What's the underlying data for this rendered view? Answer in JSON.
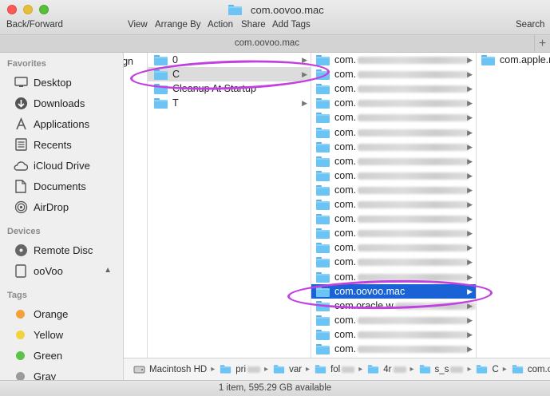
{
  "window": {
    "title": "com.oovoo.mac",
    "tab_title": "com.oovoo.mac",
    "new_tab": "+"
  },
  "toolbar": {
    "back_forward": "Back/Forward",
    "view": "View",
    "arrange_by": "Arrange By",
    "action": "Action",
    "share": "Share",
    "add_tags": "Add Tags",
    "search": "Search"
  },
  "sidebar": {
    "favorites_header": "Favorites",
    "favorites": [
      {
        "label": "Desktop",
        "icon": "desktop-icon"
      },
      {
        "label": "Downloads",
        "icon": "downloads-icon"
      },
      {
        "label": "Applications",
        "icon": "applications-icon"
      },
      {
        "label": "Recents",
        "icon": "recents-icon"
      },
      {
        "label": "iCloud Drive",
        "icon": "icloud-icon"
      },
      {
        "label": "Documents",
        "icon": "documents-icon"
      },
      {
        "label": "AirDrop",
        "icon": "airdrop-icon"
      }
    ],
    "devices_header": "Devices",
    "devices": [
      {
        "label": "Remote Disc",
        "icon": "disc-icon"
      },
      {
        "label": "ooVoo",
        "icon": "drive-icon"
      }
    ],
    "tags_header": "Tags",
    "tags": [
      {
        "label": "Orange",
        "color": "#f5a13a"
      },
      {
        "label": "Yellow",
        "color": "#f2d33b"
      },
      {
        "label": "Green",
        "color": "#5ac348"
      },
      {
        "label": "Gray",
        "color": "#9b9b9b"
      }
    ]
  },
  "columns": {
    "col0_fragment": "gn",
    "col1": [
      {
        "name": "0",
        "has_children": true,
        "state": "normal"
      },
      {
        "name": "C",
        "has_children": true,
        "state": "gray"
      },
      {
        "name": "Cleanup At Startup",
        "has_children": false,
        "state": "normal"
      },
      {
        "name": "T",
        "has_children": true,
        "state": "normal"
      }
    ],
    "col2": [
      {
        "prefix": "com.",
        "redacted": true,
        "has_children": true,
        "state": "normal"
      },
      {
        "prefix": "com.",
        "redacted": true,
        "has_children": true,
        "state": "normal"
      },
      {
        "prefix": "com.",
        "redacted": true,
        "has_children": true,
        "state": "normal"
      },
      {
        "prefix": "com.",
        "redacted": true,
        "has_children": true,
        "state": "normal"
      },
      {
        "prefix": "com.",
        "redacted": true,
        "has_children": true,
        "state": "normal"
      },
      {
        "prefix": "com.",
        "redacted": true,
        "has_children": true,
        "state": "normal"
      },
      {
        "prefix": "com.",
        "redacted": true,
        "has_children": true,
        "state": "normal"
      },
      {
        "prefix": "com.",
        "redacted": true,
        "has_children": true,
        "state": "normal"
      },
      {
        "prefix": "com.",
        "redacted": true,
        "has_children": true,
        "state": "normal"
      },
      {
        "prefix": "com.",
        "redacted": true,
        "has_children": true,
        "state": "normal"
      },
      {
        "prefix": "com.",
        "redacted": true,
        "has_children": true,
        "state": "normal"
      },
      {
        "prefix": "com.",
        "redacted": true,
        "has_children": true,
        "state": "normal"
      },
      {
        "prefix": "com.",
        "redacted": true,
        "has_children": true,
        "state": "normal"
      },
      {
        "prefix": "com.",
        "redacted": true,
        "has_children": true,
        "state": "normal"
      },
      {
        "prefix": "com.",
        "redacted": true,
        "has_children": true,
        "state": "normal"
      },
      {
        "prefix": "com.",
        "redacted": true,
        "has_children": true,
        "state": "normal"
      },
      {
        "prefix": "com.oovoo.mac",
        "redacted": false,
        "has_children": true,
        "state": "selected"
      },
      {
        "prefix": "com.oracle.w",
        "redacted": true,
        "has_children": true,
        "state": "normal"
      },
      {
        "prefix": "com.",
        "redacted": true,
        "has_children": true,
        "state": "normal"
      },
      {
        "prefix": "com.",
        "redacted": true,
        "has_children": true,
        "state": "normal"
      },
      {
        "prefix": "com.",
        "redacted": true,
        "has_children": true,
        "state": "normal"
      }
    ],
    "col3": [
      {
        "name": "com.apple.r"
      }
    ]
  },
  "pathbar": {
    "disk": "Macintosh HD",
    "segments": [
      "pri",
      "var",
      "fol",
      "4r",
      "s_s",
      "C",
      "com.oovoo.mac"
    ]
  },
  "status": {
    "text": "1 item, 595.29 GB available"
  },
  "colors": {
    "selection": "#1a63d6",
    "annotation": "#c23fe0",
    "folder": "#6cc4f4"
  }
}
